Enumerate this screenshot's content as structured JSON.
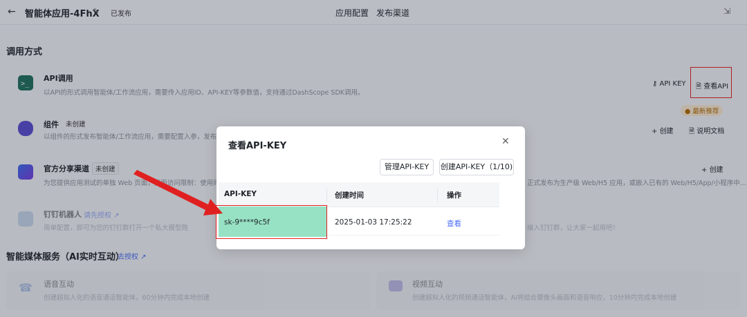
{
  "header": {
    "back_icon": "arrow-left-icon",
    "app_title": "智能体应用-4FhX",
    "status": "已发布",
    "tabs": [
      "应用配置",
      "发布渠道"
    ]
  },
  "section_call": {
    "title": "调用方式",
    "rows": [
      {
        "name": "API调用",
        "desc": "以API的形式调用智能体/工作流应用，需要传入应用ID、API-KEY等参数值，支持通过DashScope SDK调用。",
        "actions": [
          "API KEY",
          "查看API"
        ]
      },
      {
        "name": "组件",
        "tag": "未创建",
        "desc": "以组件的形式发布智能体/工作流应用，需要配置入参，发布后",
        "actions": [
          "创建",
          "说明文档"
        ],
        "badge": "最新推荐"
      },
      {
        "name": "官方分享渠道",
        "tag": "未创建",
        "desc": "为您提供应用测试的单独 Web 页面，页面访问限制：使用同一",
        "desc_right": "正式发布为生产级 Web/H5 应用，或嵌入已有的 Web/H5/App/小程序中...",
        "actions": [
          "创建"
        ]
      },
      {
        "name": "钉钉机器人",
        "auth": "请先授权",
        "desc": "简单配置，即可为您的钉钉群打开一个私大模型跑",
        "desc_right": "接入钉钉群，让大家一起用吧！"
      }
    ]
  },
  "section_media": {
    "title": "智能媒体服务（AI实时互动）",
    "auth": "去授权",
    "cards": [
      {
        "name": "语音互动",
        "desc": "创建超拟人化的语音通话智能体，60分钟内完成本地创建"
      },
      {
        "name": "视频互动",
        "desc": "创建超拟人化的视频通话智能体，AI将结合摄像头画面和语音响应，10分钟内完成本地创建"
      }
    ]
  },
  "modal": {
    "title": "查看API-KEY",
    "manage_button": "管理API-KEY",
    "create_button": "创建API-KEY（1/10)",
    "columns": [
      "API-KEY",
      "创建时间",
      "操作"
    ],
    "rows": [
      {
        "key": "sk-9****9c5f",
        "created": "2025-01-03 17:25:22",
        "action": "查看"
      }
    ]
  },
  "colors": {
    "accent": "#4a6cf7",
    "highlight": "#97e2c4",
    "annotation": "#e02020"
  }
}
